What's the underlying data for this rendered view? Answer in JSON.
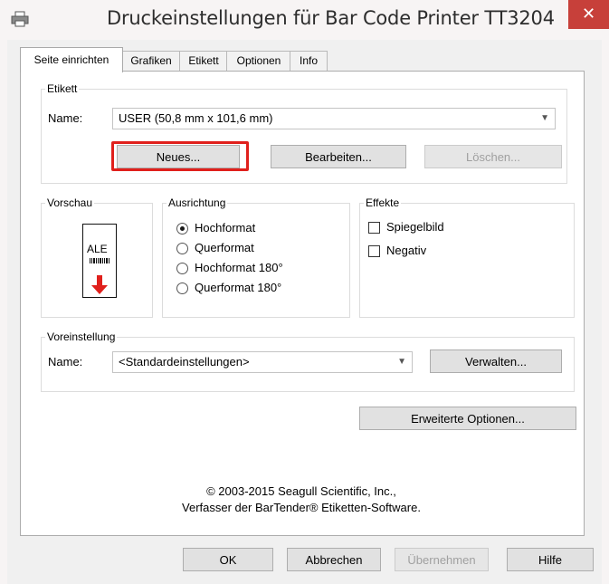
{
  "window": {
    "title": "Druckeinstellungen für Bar Code Printer TT3204",
    "close_glyph": "✕",
    "icon": "printer-icon"
  },
  "tabs": [
    {
      "label": "Seite einrichten",
      "active": true
    },
    {
      "label": "Grafiken",
      "active": false
    },
    {
      "label": "Etikett",
      "active": false
    },
    {
      "label": "Optionen",
      "active": false
    },
    {
      "label": "Info",
      "active": false
    }
  ],
  "etikett": {
    "group_label": "Etikett",
    "name_label": "Name:",
    "name_value": "USER (50,8 mm x 101,6 mm)",
    "new_button": "Neues...",
    "edit_button": "Bearbeiten...",
    "delete_button": "Löschen..."
  },
  "vorschau": {
    "group_label": "Vorschau",
    "preview_text": "ALE"
  },
  "ausrichtung": {
    "group_label": "Ausrichtung",
    "options": [
      "Hochformat",
      "Querformat",
      "Hochformat 180°",
      "Querformat 180°"
    ],
    "selected": "Hochformat"
  },
  "effekte": {
    "group_label": "Effekte",
    "options": [
      "Spiegelbild",
      "Negativ"
    ]
  },
  "voreinstellung": {
    "group_label": "Voreinstellung",
    "name_label": "Name:",
    "value": "<Standardeinstellungen>",
    "manage_button": "Verwalten..."
  },
  "advanced_button": "Erweiterte Optionen...",
  "copyright": {
    "line1": "© 2003-2015 Seagull Scientific, Inc.,",
    "line2": "Verfasser der BarTender® Etiketten-Software."
  },
  "footer": {
    "ok": "OK",
    "cancel": "Abbrechen",
    "apply": "Übernehmen",
    "help": "Hilfe"
  },
  "colors": {
    "close_button": "#c7403a",
    "highlight_box": "#e0201c",
    "arrow_red": "#e0201c"
  }
}
